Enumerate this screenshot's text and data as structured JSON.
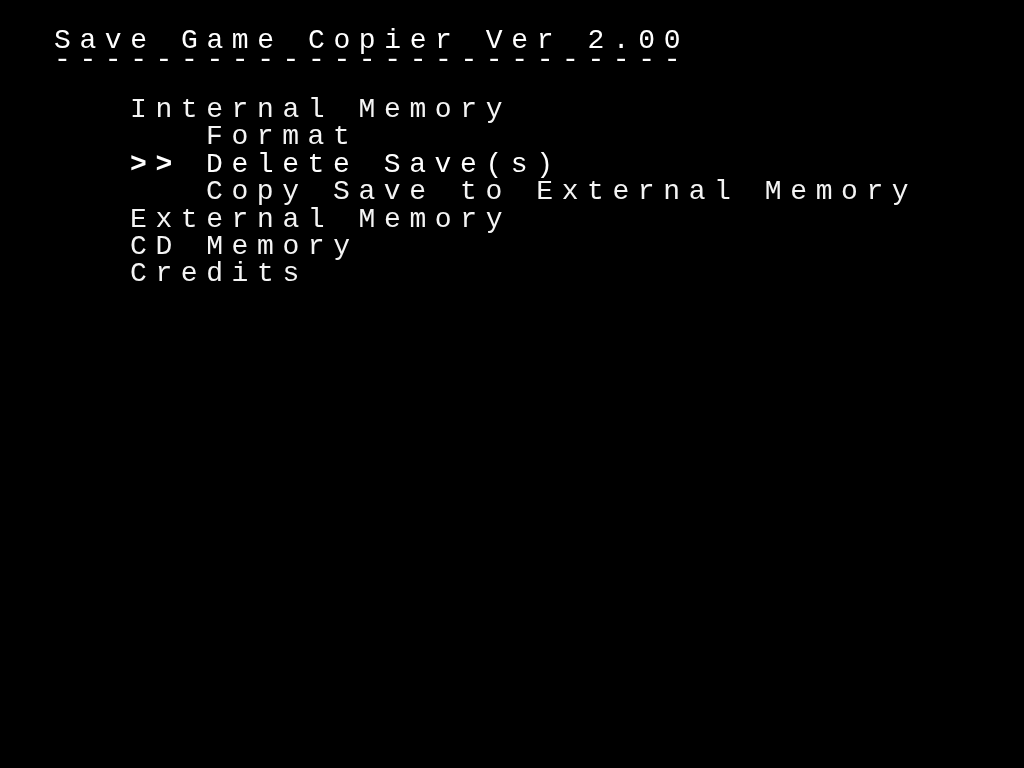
{
  "title": "Save Game Copier Ver 2.00",
  "rule": "-------------------------",
  "cursor": ">>",
  "menu": [
    {
      "label": "Internal Memory",
      "selected": false,
      "children": [
        {
          "label": "Format",
          "selected": false
        },
        {
          "label": "Delete Save(s)",
          "selected": true
        },
        {
          "label": "Copy Save to External Memory",
          "selected": false
        }
      ]
    },
    {
      "label": "External Memory",
      "selected": false
    },
    {
      "label": "CD Memory",
      "selected": false
    },
    {
      "label": "Credits",
      "selected": false
    }
  ]
}
